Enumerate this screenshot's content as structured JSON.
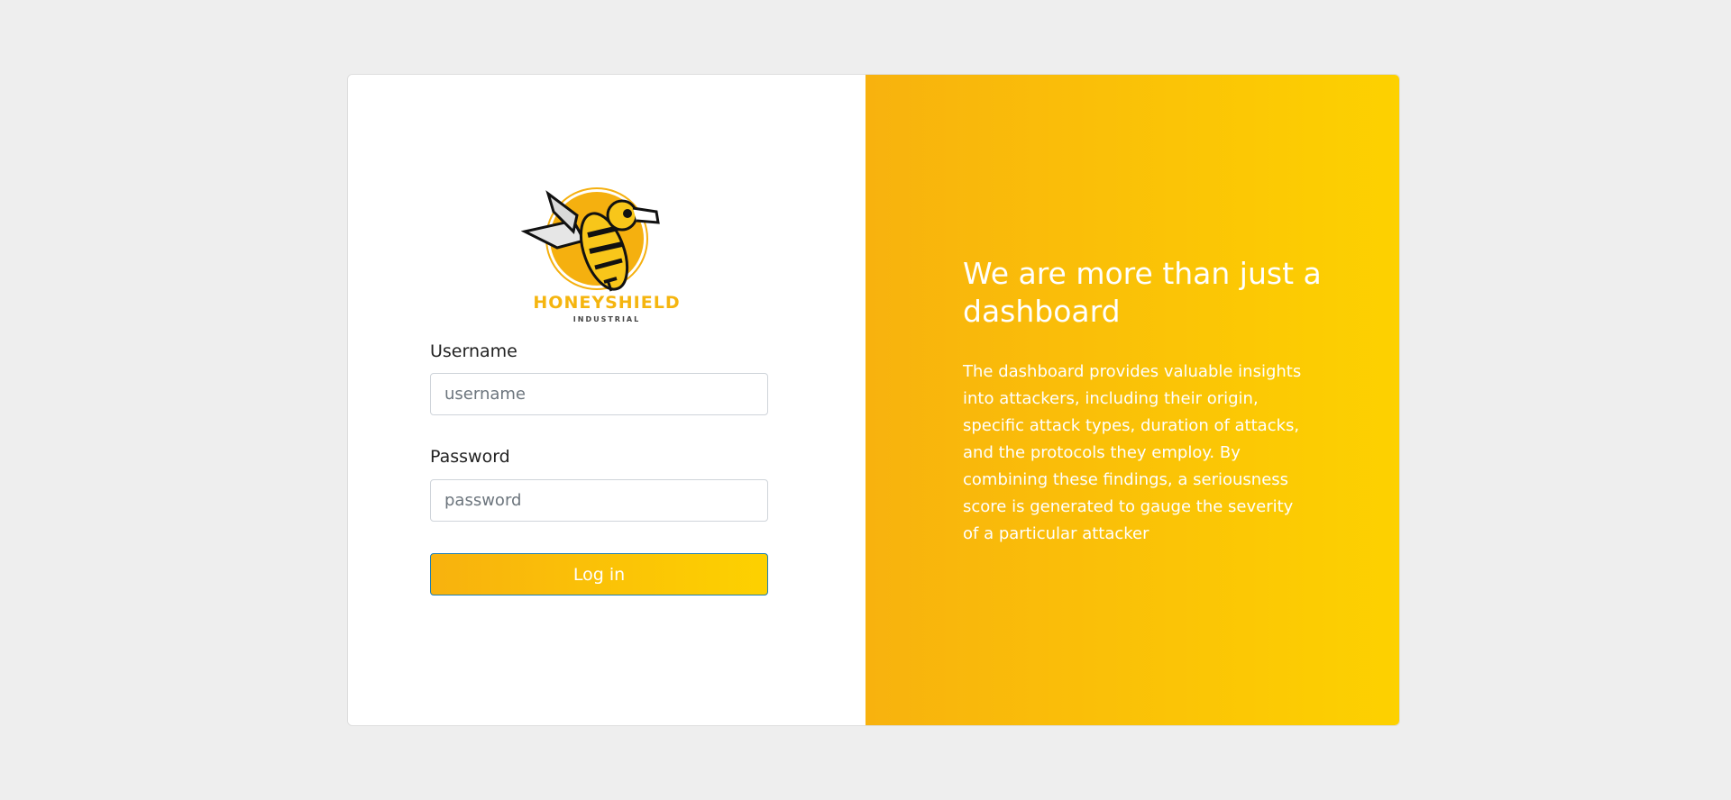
{
  "brand": {
    "name": "HONEYSHIELD",
    "subtitle": "INDUSTRIAL"
  },
  "login": {
    "username_label": "Username",
    "username_placeholder": "username",
    "username_value": "",
    "password_label": "Password",
    "password_placeholder": "password",
    "password_value": "",
    "submit_label": "Log in"
  },
  "promo": {
    "headline": "We are more than just a dashboard",
    "body": "The dashboard provides valuable insights into attackers, including their origin, specific attack types, duration of attacks, and the protocols they employ. By combining these findings, a seriousness score is generated to gauge the severity of a particular attacker"
  },
  "colors": {
    "page_background": "#eeeeee",
    "accent_gradient_start": "#f8b20e",
    "accent_gradient_end": "#fdd100",
    "brand_text": "#f5b50f",
    "button_border": "#1f7fb5"
  },
  "icons": {
    "logo": "bee-logo-icon"
  }
}
